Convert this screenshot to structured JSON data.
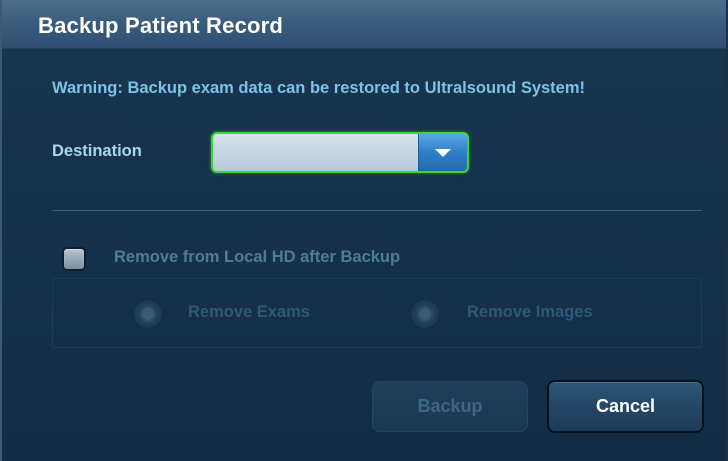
{
  "dialog": {
    "title": "Backup Patient Record",
    "warning": "Warning: Backup exam data can be restored to Ultralsound System!"
  },
  "destination": {
    "label": "Destination",
    "selected_value": "",
    "dropdown_icon": "chevron-down-icon"
  },
  "remove_option": {
    "checkbox_label": "Remove from Local HD after Backup",
    "checked": false,
    "radios": [
      {
        "label": "Remove Exams",
        "enabled": false
      },
      {
        "label": "Remove Images",
        "enabled": false
      }
    ]
  },
  "buttons": {
    "backup_label": "Backup",
    "backup_enabled": false,
    "cancel_label": "Cancel"
  },
  "colors": {
    "accent_green": "#3fd13f",
    "warning_text": "#7cc3e4",
    "dropdown_blue": "#2f7fc7"
  }
}
